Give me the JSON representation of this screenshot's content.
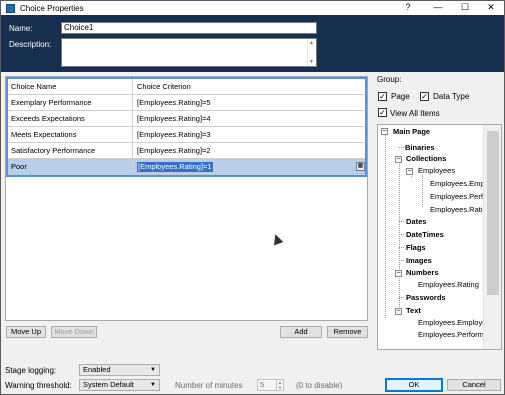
{
  "window": {
    "title": "Choice Properties",
    "help": "?",
    "minimize": "—",
    "maximize": "☐",
    "close": "✕"
  },
  "header": {
    "name_label": "Name:",
    "name_value": "Choice1",
    "description_label": "Description:",
    "description_value": ""
  },
  "grid": {
    "columns": [
      "Choice Name",
      "Choice Criterion"
    ],
    "rows": [
      {
        "name": "Exemplary Performance",
        "criterion": "[Employees.Rating]=5"
      },
      {
        "name": "Exceeds Expectations",
        "criterion": "[Employees.Rating]=4"
      },
      {
        "name": "Meets Expectations",
        "criterion": "[Employees.Rating]=3"
      },
      {
        "name": "Satisfactory Performance",
        "criterion": "[Employees.Rating]=2"
      },
      {
        "name": "Poor",
        "criterion": "[Employees.Rating]=1"
      }
    ]
  },
  "buttons": {
    "move_up": "Move Up",
    "move_down": "Move Down",
    "add": "Add",
    "remove": "Remove",
    "ok": "OK",
    "cancel": "Cancel"
  },
  "group": {
    "label": "Group:",
    "page": "Page",
    "data_type": "Data Type",
    "view_all": "View All Items"
  },
  "tree": {
    "main_page": "Main Page",
    "binaries": "Binaries",
    "collections": "Collections",
    "employees": "Employees",
    "emp_items": [
      "Employees.Empl",
      "Employees.Perfo",
      "Employees.Ratin"
    ],
    "dates": "Dates",
    "datetimes": "DateTimes",
    "flags": "Flags",
    "images": "Images",
    "numbers": "Numbers",
    "numbers_item": "Employees.Rating",
    "passwords": "Passwords",
    "text": "Text",
    "text_items": [
      "Employees.Employe",
      "Employees.Performa"
    ]
  },
  "bottom": {
    "stage_logging_label": "Stage logging:",
    "stage_logging_value": "Enabled",
    "warning_label": "Warning threshold:",
    "warning_value": "System Default",
    "minutes_label": "Number of minutes",
    "minutes_value": "5",
    "disable_hint": "(0 to disable)"
  }
}
